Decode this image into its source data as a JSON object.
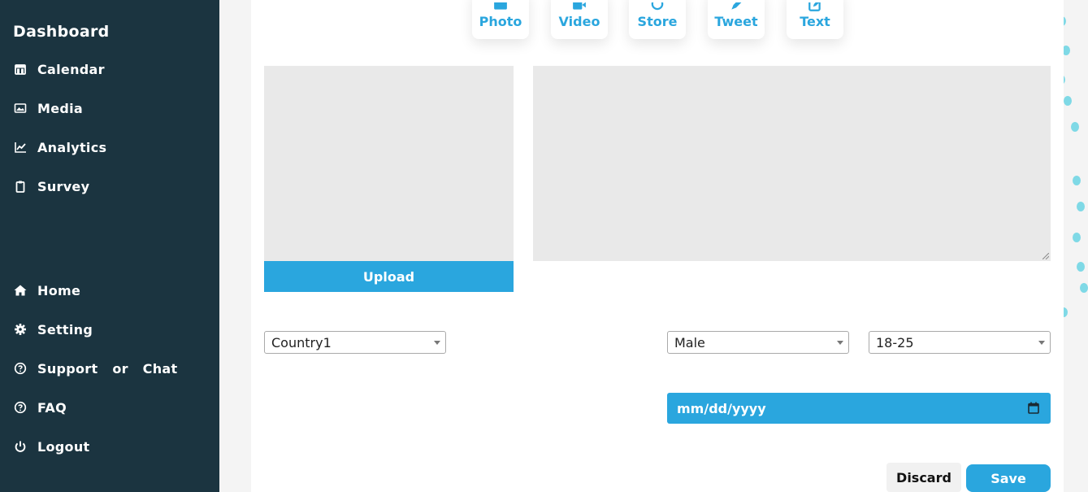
{
  "sidebar": {
    "title": "Dashboard",
    "items": [
      {
        "label": "Calendar",
        "icon": "calendar-icon"
      },
      {
        "label": "Media",
        "icon": "image-icon"
      },
      {
        "label": "Analytics",
        "icon": "line-chart-icon"
      },
      {
        "label": "Survey",
        "icon": "clipboard-icon"
      }
    ],
    "bottom_items": [
      {
        "label": "Home",
        "icon": "home-icon"
      },
      {
        "label": "Setting",
        "icon": "gear-icon"
      },
      {
        "label": "Support or Chat",
        "icon": "question-circle-icon"
      },
      {
        "label": "FAQ",
        "icon": "question-circle-icon"
      },
      {
        "label": "Logout",
        "icon": "power-icon"
      }
    ]
  },
  "post_types": [
    {
      "label": "Photo",
      "icon": "image-icon"
    },
    {
      "label": "Video",
      "icon": "video-camera-icon"
    },
    {
      "label": "Store",
      "icon": "circle-icon"
    },
    {
      "label": "Tweet",
      "icon": "pen-icon"
    },
    {
      "label": "Text",
      "icon": "edit-icon"
    }
  ],
  "upload": {
    "label": "Upload"
  },
  "filters": {
    "country": "Country1",
    "gender": "Male",
    "age": "18-25"
  },
  "date": {
    "placeholder": "mm/dd/yyyy"
  },
  "actions": {
    "discard": "Discard",
    "save": "Save"
  },
  "colors": {
    "sidebar_bg": "#1b3440",
    "accent": "#2aa6de",
    "panel_gray": "#e9e9e9",
    "dots": "#7fd9e6"
  }
}
